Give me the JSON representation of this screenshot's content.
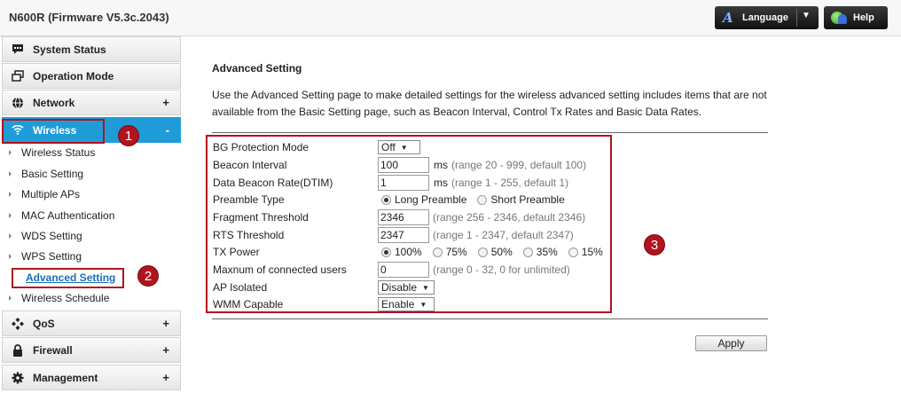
{
  "header": {
    "title": "N600R (Firmware V5.3c.2043)",
    "language_label": "Language",
    "help_label": "Help"
  },
  "sidebar": {
    "items": [
      {
        "label": "System Status",
        "icon": "chat-icon",
        "sign": ""
      },
      {
        "label": "Operation Mode",
        "icon": "window-icon",
        "sign": ""
      },
      {
        "label": "Network",
        "icon": "globe-icon",
        "sign": "+"
      },
      {
        "label": "Wireless",
        "icon": "wifi-icon",
        "sign": "-"
      },
      {
        "label": "QoS",
        "icon": "qos-icon",
        "sign": "+"
      },
      {
        "label": "Firewall",
        "icon": "lock-icon",
        "sign": "+"
      },
      {
        "label": "Management",
        "icon": "gear-icon",
        "sign": "+"
      }
    ],
    "wireless_sub": [
      "Wireless Status",
      "Basic Setting",
      "Multiple APs",
      "MAC Authentication",
      "WDS Setting",
      "WPS Setting",
      "Advanced Setting",
      "Wireless Schedule"
    ]
  },
  "callouts": {
    "one": "1",
    "two": "2",
    "three": "3"
  },
  "main": {
    "title": "Advanced Setting",
    "description": "Use the Advanced Setting page to make detailed settings for the wireless advanced setting includes items that are not available from the Basic Setting page, such as Beacon Interval, Control Tx Rates and Basic Data Rates.",
    "bg_protection": {
      "label": "BG Protection Mode",
      "value": "Off"
    },
    "beacon_interval": {
      "label": "Beacon Interval",
      "value": "100",
      "unit": "ms",
      "hint": "(range 20 - 999, default 100)"
    },
    "dtim": {
      "label": "Data Beacon Rate(DTIM)",
      "value": "1",
      "unit": "ms",
      "hint": "(range 1 - 255, default 1)"
    },
    "preamble": {
      "label": "Preamble Type",
      "options": [
        "Long Preamble",
        "Short Preamble"
      ],
      "selected": "Long Preamble"
    },
    "fragment": {
      "label": "Fragment Threshold",
      "value": "2346",
      "hint": "(range 256 - 2346, default 2346)"
    },
    "rts": {
      "label": "RTS Threshold",
      "value": "2347",
      "hint": "(range 1 - 2347, default 2347)"
    },
    "tx_power": {
      "label": "TX Power",
      "options": [
        "100%",
        "75%",
        "50%",
        "35%",
        "15%"
      ],
      "selected": "100%"
    },
    "max_users": {
      "label": "Maxnum of connected users",
      "value": "0",
      "hint": "(range 0 - 32, 0 for unlimited)"
    },
    "ap_isolated": {
      "label": "AP Isolated",
      "value": "Disable"
    },
    "wmm": {
      "label": "WMM Capable",
      "value": "Enable"
    },
    "apply_label": "Apply"
  },
  "colors": {
    "accent": "#1f9cd8",
    "highlight": "#b0141e"
  }
}
